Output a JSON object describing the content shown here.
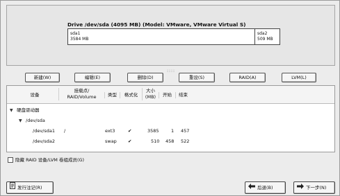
{
  "drive": {
    "title": "Drive /dev/sda (4095 MB) (Model: VMware, VMware Virtual S)",
    "segments": [
      {
        "name": "sda1",
        "size": "3584 MB"
      },
      {
        "name": "sda2",
        "size": "509 MB"
      }
    ]
  },
  "handle": "::::",
  "buttons": {
    "new": "新建(W)",
    "edit": "编辑(E)",
    "delete": "删除(D)",
    "reset": "重设(S)",
    "raid": "RAID(A)",
    "lvm": "LVM(L)"
  },
  "table": {
    "headers": {
      "device": "设备",
      "mount_line1": "挂载点/",
      "mount_line2": "RAID/Volume",
      "type": "类型",
      "format": "格式化",
      "size_line1": "大小",
      "size_line2": "(MB)",
      "start": "开始",
      "end": "结束"
    },
    "group": "硬盘驱动器",
    "disk": "/dev/sda",
    "rows": [
      {
        "device": "/dev/sda1",
        "mount": "/",
        "type": "ext3",
        "format": "✔",
        "size": "3585",
        "start": "1",
        "end": "457"
      },
      {
        "device": "/dev/sda2",
        "mount": "",
        "type": "swap",
        "format": "✔",
        "size": "510",
        "start": "458",
        "end": "522"
      }
    ]
  },
  "hide_option": {
    "label": "隐藏 RAID 设备/LVM 卷组成员(G)",
    "checked": false
  },
  "footer": {
    "release_notes": "发行注记(R)",
    "back": "后退(B)",
    "next": "下一步(N)"
  }
}
